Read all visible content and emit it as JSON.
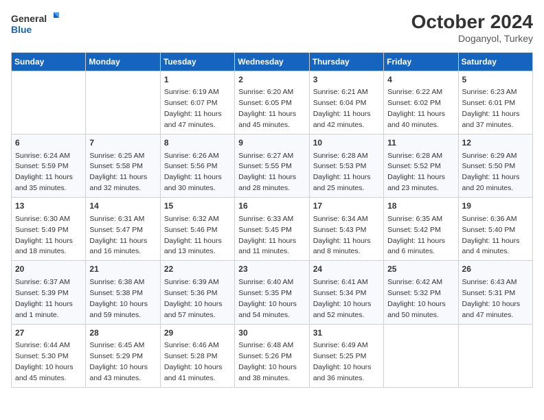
{
  "header": {
    "logo_line1": "General",
    "logo_line2": "Blue",
    "month": "October 2024",
    "location": "Doganyol, Turkey"
  },
  "weekdays": [
    "Sunday",
    "Monday",
    "Tuesday",
    "Wednesday",
    "Thursday",
    "Friday",
    "Saturday"
  ],
  "weeks": [
    [
      {
        "day": "",
        "info": ""
      },
      {
        "day": "",
        "info": ""
      },
      {
        "day": "1",
        "info": "Sunrise: 6:19 AM\nSunset: 6:07 PM\nDaylight: 11 hours and 47 minutes."
      },
      {
        "day": "2",
        "info": "Sunrise: 6:20 AM\nSunset: 6:05 PM\nDaylight: 11 hours and 45 minutes."
      },
      {
        "day": "3",
        "info": "Sunrise: 6:21 AM\nSunset: 6:04 PM\nDaylight: 11 hours and 42 minutes."
      },
      {
        "day": "4",
        "info": "Sunrise: 6:22 AM\nSunset: 6:02 PM\nDaylight: 11 hours and 40 minutes."
      },
      {
        "day": "5",
        "info": "Sunrise: 6:23 AM\nSunset: 6:01 PM\nDaylight: 11 hours and 37 minutes."
      }
    ],
    [
      {
        "day": "6",
        "info": "Sunrise: 6:24 AM\nSunset: 5:59 PM\nDaylight: 11 hours and 35 minutes."
      },
      {
        "day": "7",
        "info": "Sunrise: 6:25 AM\nSunset: 5:58 PM\nDaylight: 11 hours and 32 minutes."
      },
      {
        "day": "8",
        "info": "Sunrise: 6:26 AM\nSunset: 5:56 PM\nDaylight: 11 hours and 30 minutes."
      },
      {
        "day": "9",
        "info": "Sunrise: 6:27 AM\nSunset: 5:55 PM\nDaylight: 11 hours and 28 minutes."
      },
      {
        "day": "10",
        "info": "Sunrise: 6:28 AM\nSunset: 5:53 PM\nDaylight: 11 hours and 25 minutes."
      },
      {
        "day": "11",
        "info": "Sunrise: 6:28 AM\nSunset: 5:52 PM\nDaylight: 11 hours and 23 minutes."
      },
      {
        "day": "12",
        "info": "Sunrise: 6:29 AM\nSunset: 5:50 PM\nDaylight: 11 hours and 20 minutes."
      }
    ],
    [
      {
        "day": "13",
        "info": "Sunrise: 6:30 AM\nSunset: 5:49 PM\nDaylight: 11 hours and 18 minutes."
      },
      {
        "day": "14",
        "info": "Sunrise: 6:31 AM\nSunset: 5:47 PM\nDaylight: 11 hours and 16 minutes."
      },
      {
        "day": "15",
        "info": "Sunrise: 6:32 AM\nSunset: 5:46 PM\nDaylight: 11 hours and 13 minutes."
      },
      {
        "day": "16",
        "info": "Sunrise: 6:33 AM\nSunset: 5:45 PM\nDaylight: 11 hours and 11 minutes."
      },
      {
        "day": "17",
        "info": "Sunrise: 6:34 AM\nSunset: 5:43 PM\nDaylight: 11 hours and 8 minutes."
      },
      {
        "day": "18",
        "info": "Sunrise: 6:35 AM\nSunset: 5:42 PM\nDaylight: 11 hours and 6 minutes."
      },
      {
        "day": "19",
        "info": "Sunrise: 6:36 AM\nSunset: 5:40 PM\nDaylight: 11 hours and 4 minutes."
      }
    ],
    [
      {
        "day": "20",
        "info": "Sunrise: 6:37 AM\nSunset: 5:39 PM\nDaylight: 11 hours and 1 minute."
      },
      {
        "day": "21",
        "info": "Sunrise: 6:38 AM\nSunset: 5:38 PM\nDaylight: 10 hours and 59 minutes."
      },
      {
        "day": "22",
        "info": "Sunrise: 6:39 AM\nSunset: 5:36 PM\nDaylight: 10 hours and 57 minutes."
      },
      {
        "day": "23",
        "info": "Sunrise: 6:40 AM\nSunset: 5:35 PM\nDaylight: 10 hours and 54 minutes."
      },
      {
        "day": "24",
        "info": "Sunrise: 6:41 AM\nSunset: 5:34 PM\nDaylight: 10 hours and 52 minutes."
      },
      {
        "day": "25",
        "info": "Sunrise: 6:42 AM\nSunset: 5:32 PM\nDaylight: 10 hours and 50 minutes."
      },
      {
        "day": "26",
        "info": "Sunrise: 6:43 AM\nSunset: 5:31 PM\nDaylight: 10 hours and 47 minutes."
      }
    ],
    [
      {
        "day": "27",
        "info": "Sunrise: 6:44 AM\nSunset: 5:30 PM\nDaylight: 10 hours and 45 minutes."
      },
      {
        "day": "28",
        "info": "Sunrise: 6:45 AM\nSunset: 5:29 PM\nDaylight: 10 hours and 43 minutes."
      },
      {
        "day": "29",
        "info": "Sunrise: 6:46 AM\nSunset: 5:28 PM\nDaylight: 10 hours and 41 minutes."
      },
      {
        "day": "30",
        "info": "Sunrise: 6:48 AM\nSunset: 5:26 PM\nDaylight: 10 hours and 38 minutes."
      },
      {
        "day": "31",
        "info": "Sunrise: 6:49 AM\nSunset: 5:25 PM\nDaylight: 10 hours and 36 minutes."
      },
      {
        "day": "",
        "info": ""
      },
      {
        "day": "",
        "info": ""
      }
    ]
  ]
}
